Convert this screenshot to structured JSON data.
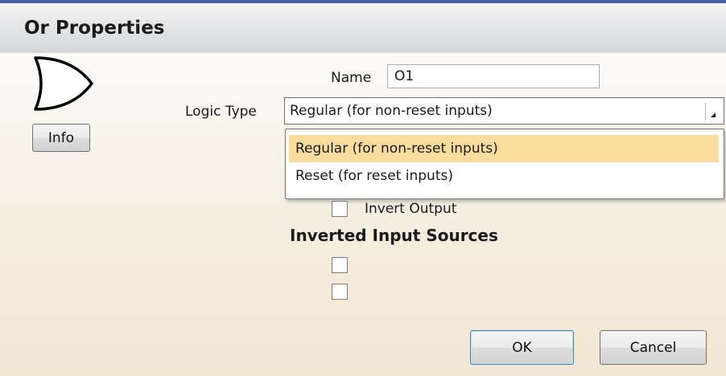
{
  "dialog": {
    "title": "Or Properties",
    "gate_icon": "or-gate-icon"
  },
  "buttons": {
    "info_label": "Info",
    "ok_label": "OK",
    "cancel_label": "Cancel"
  },
  "form": {
    "name_label": "Name",
    "name_value": "O1",
    "logic_type_label": "Logic Type",
    "logic_type_value": "Regular (for non-reset inputs)",
    "logic_type_options": [
      {
        "label": "Regular (for non-reset inputs)",
        "highlighted": true
      },
      {
        "label": "Reset (for reset inputs)",
        "highlighted": false
      }
    ],
    "invert_output_label": "Invert Output",
    "invert_output_checked": false
  },
  "inverted_inputs": {
    "heading": "Inverted Input Sources",
    "checkboxes": [
      false,
      false
    ]
  },
  "colors": {
    "title_border": "#4a60a8",
    "highlight": "#fbdca0",
    "default_button_border": "#3c7fb1"
  }
}
